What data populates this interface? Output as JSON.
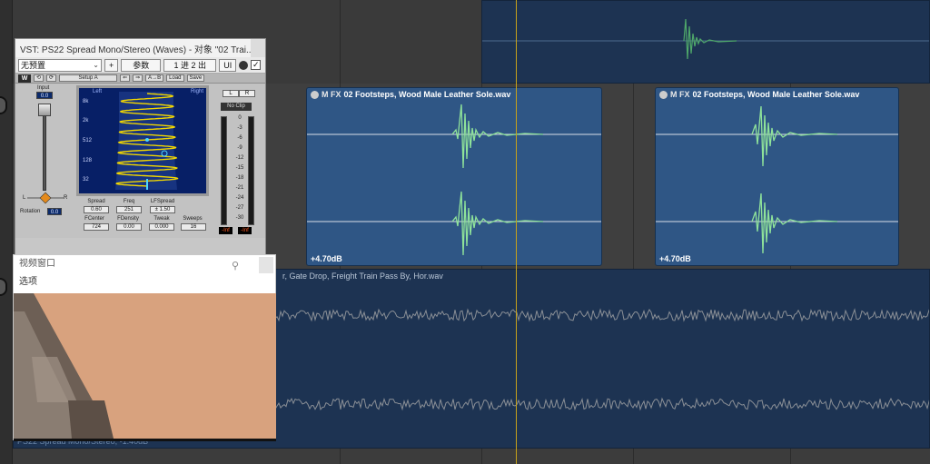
{
  "vst_window": {
    "title": "VST: PS22 Spread Mono/Stereo (Waves) - 对象 \"02 Trai...",
    "preset": "无预置",
    "plus_label": "+",
    "params_button": "参数",
    "io_button": "1 进 2 出",
    "ui_button": "UI",
    "checkbox_mark": "✓",
    "waves_bar": {
      "logo": "W",
      "undo_label": "⟲",
      "redo_label": "⟳",
      "setup_label": "Setup A",
      "left_arrow": "⇐",
      "right_arrow": "⇒",
      "ab_label": "A→B",
      "load_label": "Load",
      "save_label": "Save"
    },
    "input_label": "Input",
    "input_value": "0.0",
    "rotation_label": "Rotation",
    "rotation_value": "0.0",
    "lr_left": "L",
    "lr_right": "R",
    "display": {
      "left_label": "Left",
      "right_label": "Right",
      "freq_ticks": [
        "8k",
        "2k",
        "512",
        "128",
        "32"
      ]
    },
    "params": {
      "spread_label": "Spread",
      "spread_value": "0.60",
      "freq_label": "Freq",
      "freq_value": "251",
      "lfspread_label": "LFSpread",
      "lfspread_value": "± 1.50",
      "fcenter_label": "FCenter",
      "fcenter_value": "724",
      "fdensity_label": "FDensity",
      "fdensity_value": "0.00",
      "tweak_label": "Tweak",
      "tweak_value": "0.000",
      "sweeps_label": "Sweeps",
      "sweeps_value": "16"
    },
    "meter": {
      "l_button": "L",
      "r_button": "R",
      "noclip": "No Clip",
      "ticks": [
        "0",
        "-3",
        "-6",
        "-9",
        "-12",
        "-15",
        "-18",
        "-21",
        "-24",
        "-27",
        "-30"
      ],
      "left_peak": "-Inf",
      "right_peak": "-Inf"
    },
    "footer_label": "PS22 Spread..."
  },
  "video_window": {
    "title": "视频窗口",
    "menu_options": "选项",
    "pin_icon": "⚲"
  },
  "clips": {
    "clip_a": {
      "mfx": "M FX",
      "name": "02 Footsteps, Wood Male Leather Sole.wav",
      "gain": "+4.70dB"
    },
    "clip_b": {
      "mfx": "M FX",
      "name": "02 Footsteps, Wood Male Leather Sole.wav",
      "gain": "+4.70dB"
    },
    "clip_long": {
      "name": "r, Gate Drop, Freight Train Pass By, Hor.wav",
      "footer": "PS22 Spread Mono/Stereo, -1.40dB"
    }
  },
  "colors": {
    "clip_blue": "#2f5685",
    "clip_dark": "#1d3352",
    "waveform_green": "#7fd08a",
    "playhead": "#c7a21a",
    "display_navy": "#071f66",
    "spiral_yellow": "#f2d700"
  }
}
